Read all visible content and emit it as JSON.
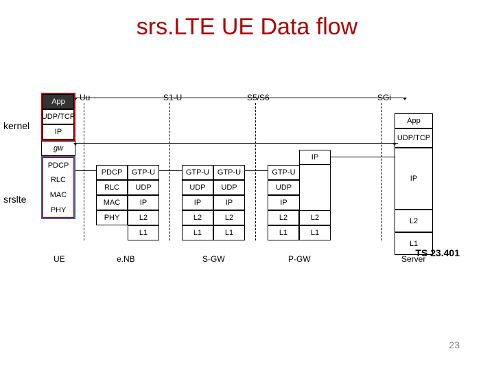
{
  "title": "srs.LTE UE Data flow",
  "side_labels": {
    "kernel": "kernel",
    "srslte": "srslte"
  },
  "interfaces": {
    "uu": "Uu",
    "s1u": "S1-U",
    "s5s6": "S5/S6",
    "sgi": "SGi"
  },
  "ue": {
    "app": "App",
    "udptcp": "UDP/TCP",
    "ip": "IP",
    "gw": "gw",
    "pdcp": "PDCP",
    "rlc": "RLC",
    "mac": "MAC",
    "phy": "PHY",
    "label": "UE"
  },
  "enb": {
    "pdcp": "PDCP",
    "gtpu": "GTP-U",
    "rlc": "RLC",
    "udp": "UDP",
    "mac": "MAC",
    "ip": "IP",
    "phy": "PHY",
    "l2": "L2",
    "l1": "L1",
    "label": "e.NB"
  },
  "sgw": {
    "gtpu_a": "GTP-U",
    "gtpu_b": "GTP-U",
    "udp_a": "UDP",
    "udp_b": "UDP",
    "ip_a": "IP",
    "ip_b": "IP",
    "l2_a": "L2",
    "l2_b": "L2",
    "l1_a": "L1",
    "l1_b": "L1",
    "label": "S-GW"
  },
  "pgw": {
    "ip_top": "IP",
    "gtpu": "GTP-U",
    "udp": "UDP",
    "ip": "IP",
    "l2_a": "L2",
    "l2_b": "L2",
    "l1_a": "L1",
    "l1_b": "L1",
    "label": "P-GW"
  },
  "server": {
    "app": "App",
    "udptcp": "UDP/TCP",
    "ip": "IP",
    "l2": "L2",
    "l1": "L1",
    "label": "Server"
  },
  "ts": "TS 23.401",
  "page": "23"
}
